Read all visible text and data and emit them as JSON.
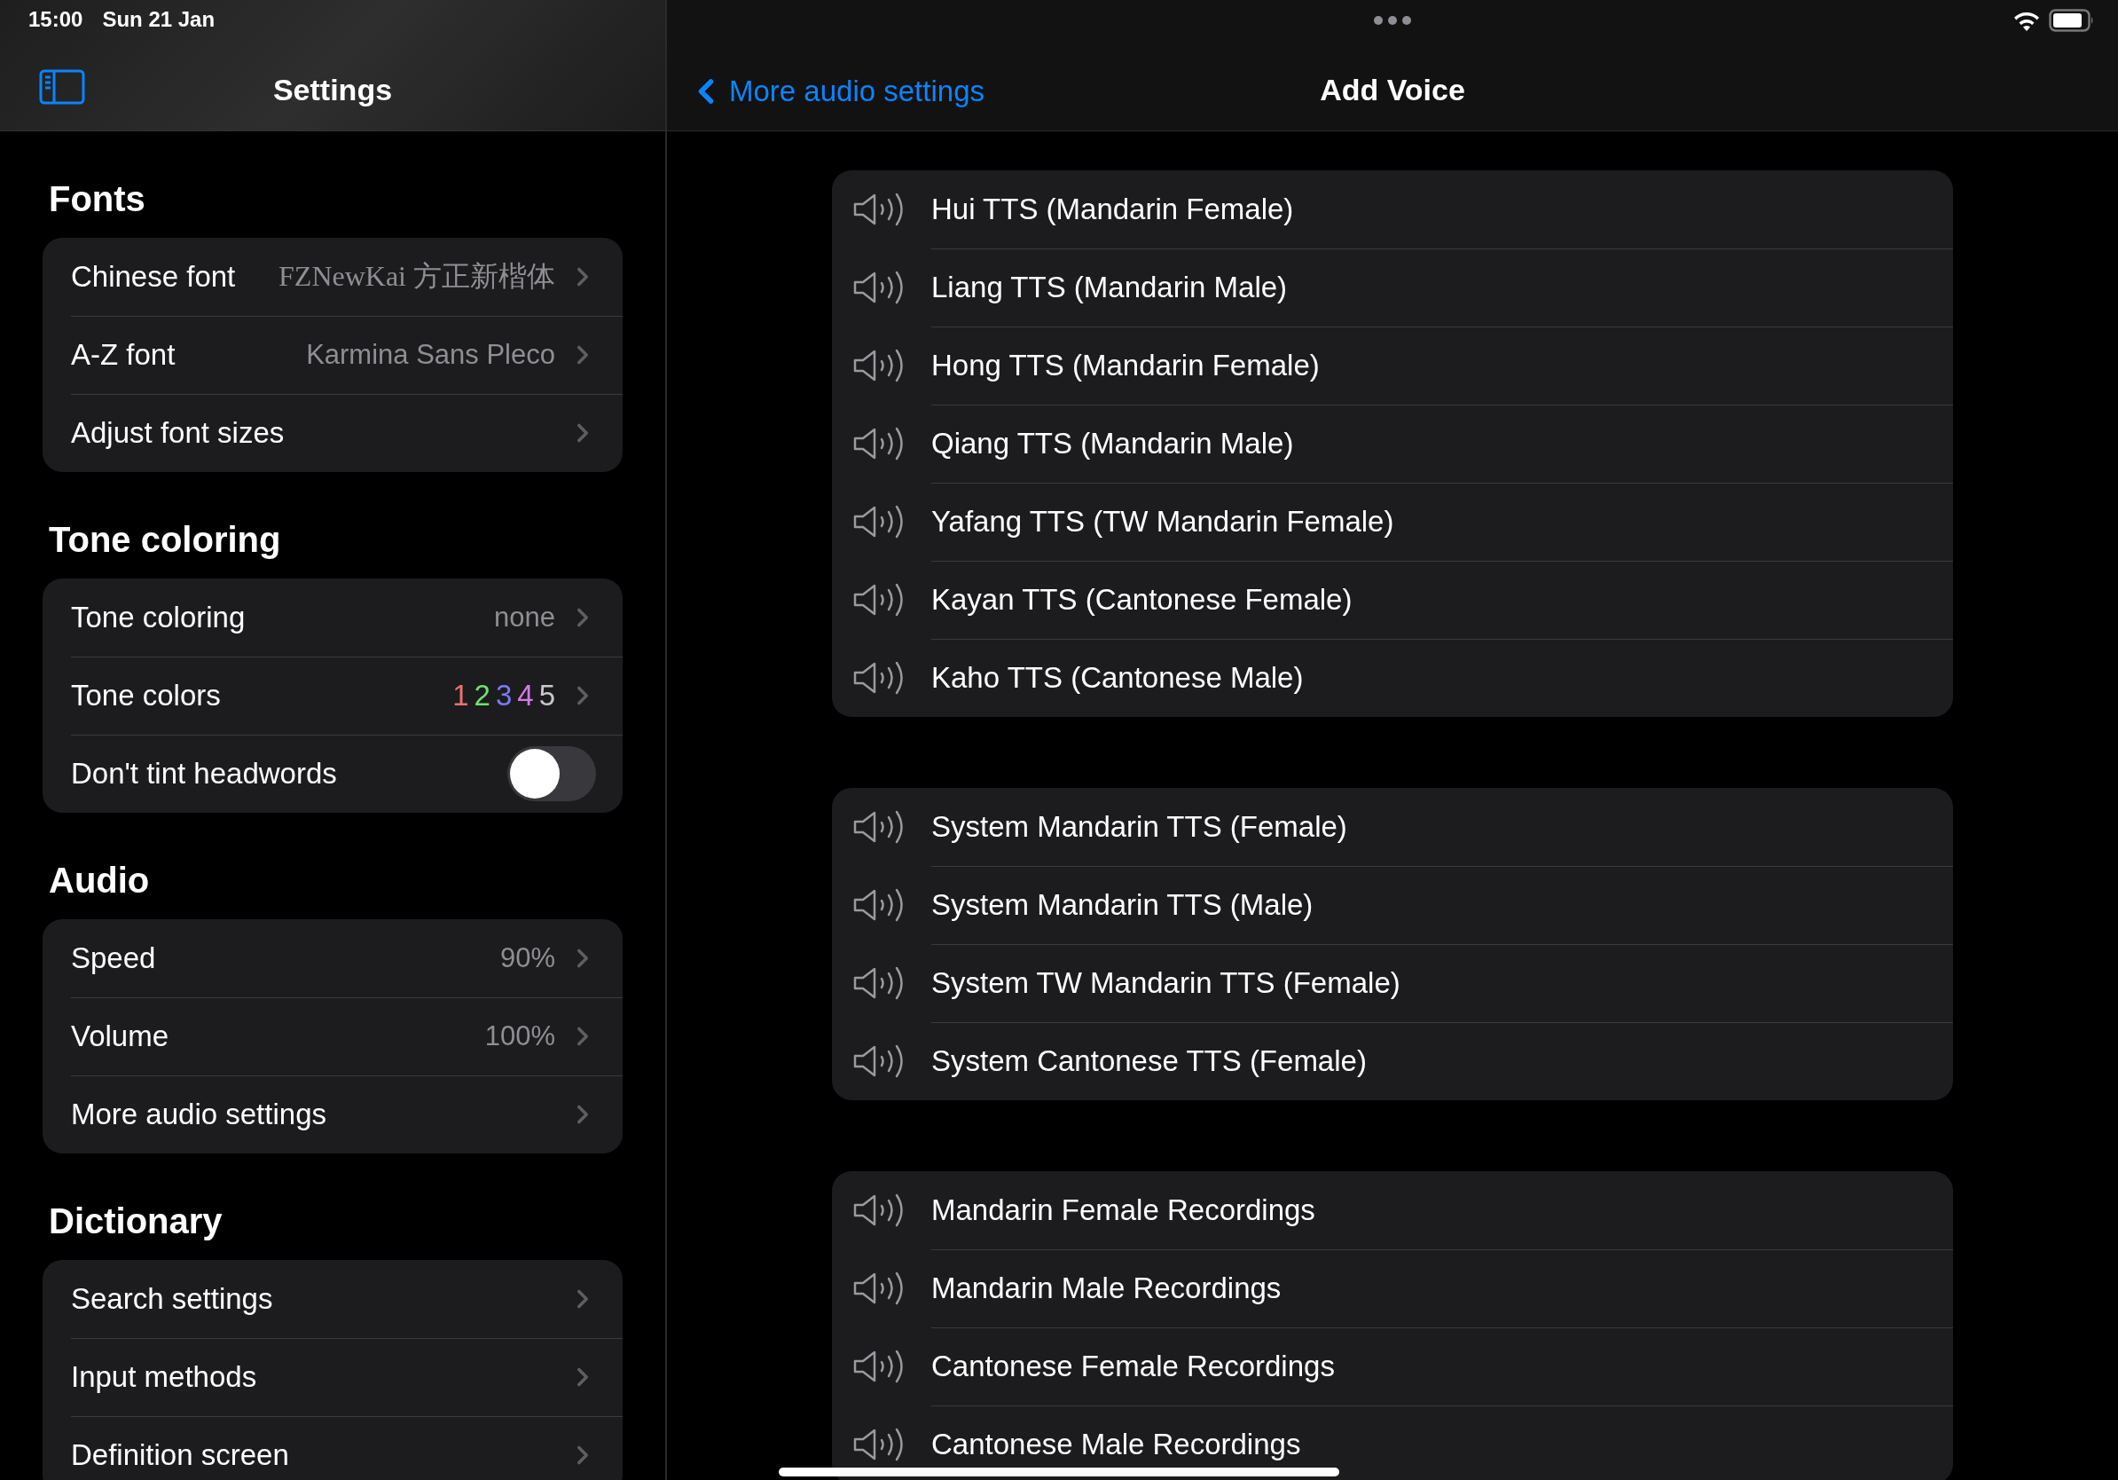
{
  "status_bar": {
    "time": "15:00",
    "date": "Sun 21 Jan"
  },
  "sidebar": {
    "title": "Settings",
    "sections": [
      {
        "title": "Fonts",
        "rows": [
          {
            "kind": "link",
            "label": "Chinese font",
            "value": "FZNewKai 方正新楷体",
            "serif": true
          },
          {
            "kind": "link",
            "label": "A-Z font",
            "value": "Karmina Sans Pleco"
          },
          {
            "kind": "link",
            "label": "Adjust font sizes"
          }
        ]
      },
      {
        "title": "Tone coloring",
        "rows": [
          {
            "kind": "link",
            "label": "Tone coloring",
            "value": "none"
          },
          {
            "kind": "colors",
            "label": "Tone colors",
            "digits": [
              {
                "text": "1",
                "color": "#f07070"
              },
              {
                "text": "2",
                "color": "#70e070"
              },
              {
                "text": "3",
                "color": "#7a7af5"
              },
              {
                "text": "4",
                "color": "#d47ae8"
              },
              {
                "text": "5",
                "color": "#c8c8c8"
              }
            ]
          },
          {
            "kind": "toggle",
            "label": "Don't tint headwords",
            "on": false
          }
        ]
      },
      {
        "title": "Audio",
        "rows": [
          {
            "kind": "link",
            "label": "Speed",
            "value": "90%"
          },
          {
            "kind": "link",
            "label": "Volume",
            "value": "100%"
          },
          {
            "kind": "link",
            "label": "More audio settings"
          }
        ]
      },
      {
        "title": "Dictionary",
        "rows": [
          {
            "kind": "link",
            "label": "Search settings"
          },
          {
            "kind": "link",
            "label": "Input methods"
          },
          {
            "kind": "link",
            "label": "Definition screen"
          }
        ]
      }
    ]
  },
  "detail": {
    "back_label": "More audio settings",
    "title": "Add Voice",
    "groups": [
      {
        "items": [
          "Hui TTS (Mandarin Female)",
          "Liang TTS (Mandarin Male)",
          "Hong TTS (Mandarin Female)",
          "Qiang TTS (Mandarin Male)",
          "Yafang TTS (TW Mandarin Female)",
          "Kayan TTS (Cantonese Female)",
          "Kaho TTS (Cantonese Male)"
        ]
      },
      {
        "items": [
          "System Mandarin TTS (Female)",
          "System Mandarin TTS (Male)",
          "System TW Mandarin TTS (Female)",
          "System Cantonese TTS (Female)"
        ]
      },
      {
        "items": [
          "Mandarin Female Recordings",
          "Mandarin Male Recordings",
          "Cantonese Female Recordings",
          "Cantonese Male Recordings"
        ]
      }
    ]
  }
}
